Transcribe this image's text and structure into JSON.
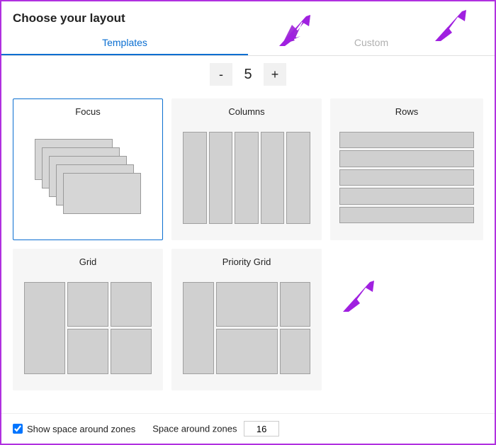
{
  "title": "Choose your layout",
  "tabs": {
    "templates": "Templates",
    "custom": "Custom"
  },
  "stepper": {
    "minus": "-",
    "value": "5",
    "plus": "+"
  },
  "templates": {
    "focus": "Focus",
    "columns": "Columns",
    "rows": "Rows",
    "grid": "Grid",
    "priority_grid": "Priority Grid"
  },
  "footer": {
    "show_space_label": "Show space around zones",
    "show_space_checked": true,
    "space_label": "Space around zones",
    "space_value": "16"
  },
  "annotation_color": "#a020e0"
}
